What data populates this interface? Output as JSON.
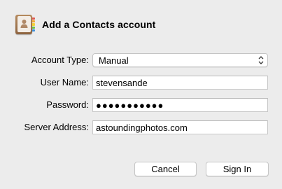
{
  "dialog": {
    "title": "Add a Contacts account",
    "icon": "contacts-app-icon"
  },
  "form": {
    "account_type": {
      "label": "Account Type:",
      "value": "Manual",
      "icon": "updown-chevron-icon"
    },
    "user_name": {
      "label": "User Name:",
      "value": "stevensande"
    },
    "password": {
      "label": "Password:",
      "value": "●●●●●●●●●●●"
    },
    "server_address": {
      "label": "Server Address:",
      "value": "astoundingphotos.com"
    }
  },
  "buttons": {
    "cancel_label": "Cancel",
    "sign_in_label": "Sign In"
  },
  "colors": {
    "window_bg": "#ececec",
    "field_border": "#c8c8c8",
    "icon_brown": "#a07650"
  }
}
